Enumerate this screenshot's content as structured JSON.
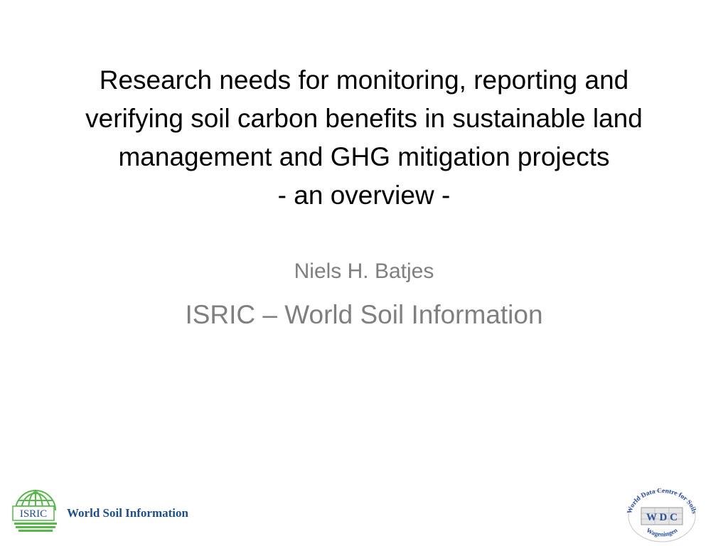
{
  "slide": {
    "title_lines": [
      "Research needs for monitoring, reporting and",
      "verifying soil carbon benefits in sustainable land",
      "management and GHG mitigation projects",
      "- an overview -"
    ],
    "author": "Niels H. Batjes",
    "affiliation": "ISRIC – World Soil Information"
  },
  "logos": {
    "isric": {
      "badge": "ISRIC",
      "wordmark": "World Soil Information",
      "colors": {
        "green": "#55b848",
        "blue": "#1d4f8b"
      }
    },
    "wdc": {
      "ring_text_top": "World Data Centre for Soils",
      "ring_text_bottom": "Wageningen",
      "center": "W D C",
      "colors": {
        "blue": "#2b4f9e",
        "grey": "#9a9a9a"
      }
    }
  }
}
